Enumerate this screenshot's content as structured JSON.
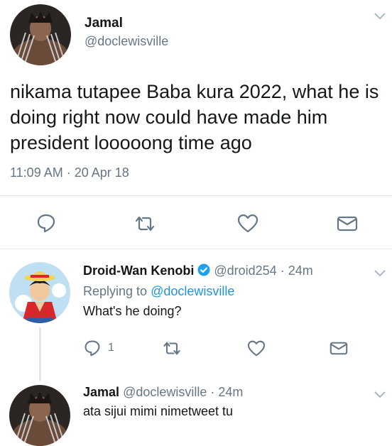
{
  "main_tweet": {
    "author_name": "Jamal",
    "author_handle": "@doclewisville",
    "text": "nikama tutapee Baba kura 2022, what he is doing right now could have made him president looooong time ago",
    "timestamp": "11:09 AM · 20 Apr 18"
  },
  "reply_1": {
    "author_name": "Droid-Wan Kenobi",
    "author_handle": "@droid254",
    "time": "· 24m",
    "replying_prefix": "Replying to",
    "replying_handle": "@doclewisville",
    "text": "What's he doing?",
    "reply_count": "1"
  },
  "reply_2": {
    "author_name": "Jamal",
    "author_handle": "@doclewisville",
    "time": "· 24m",
    "text": "ata sijui mimi nimetweet tu"
  },
  "icons": {
    "reply": "reply-icon",
    "retweet": "retweet-icon",
    "like": "heart-icon",
    "dm": "envelope-icon",
    "verified": "verified-badge-icon",
    "menu": "chevron-down-icon"
  },
  "colors": {
    "text": "#14171a",
    "muted": "#657786",
    "link": "#1b95e0",
    "verified": "#1da1f2",
    "icon": "#657786",
    "divider": "#e1e8ed"
  }
}
